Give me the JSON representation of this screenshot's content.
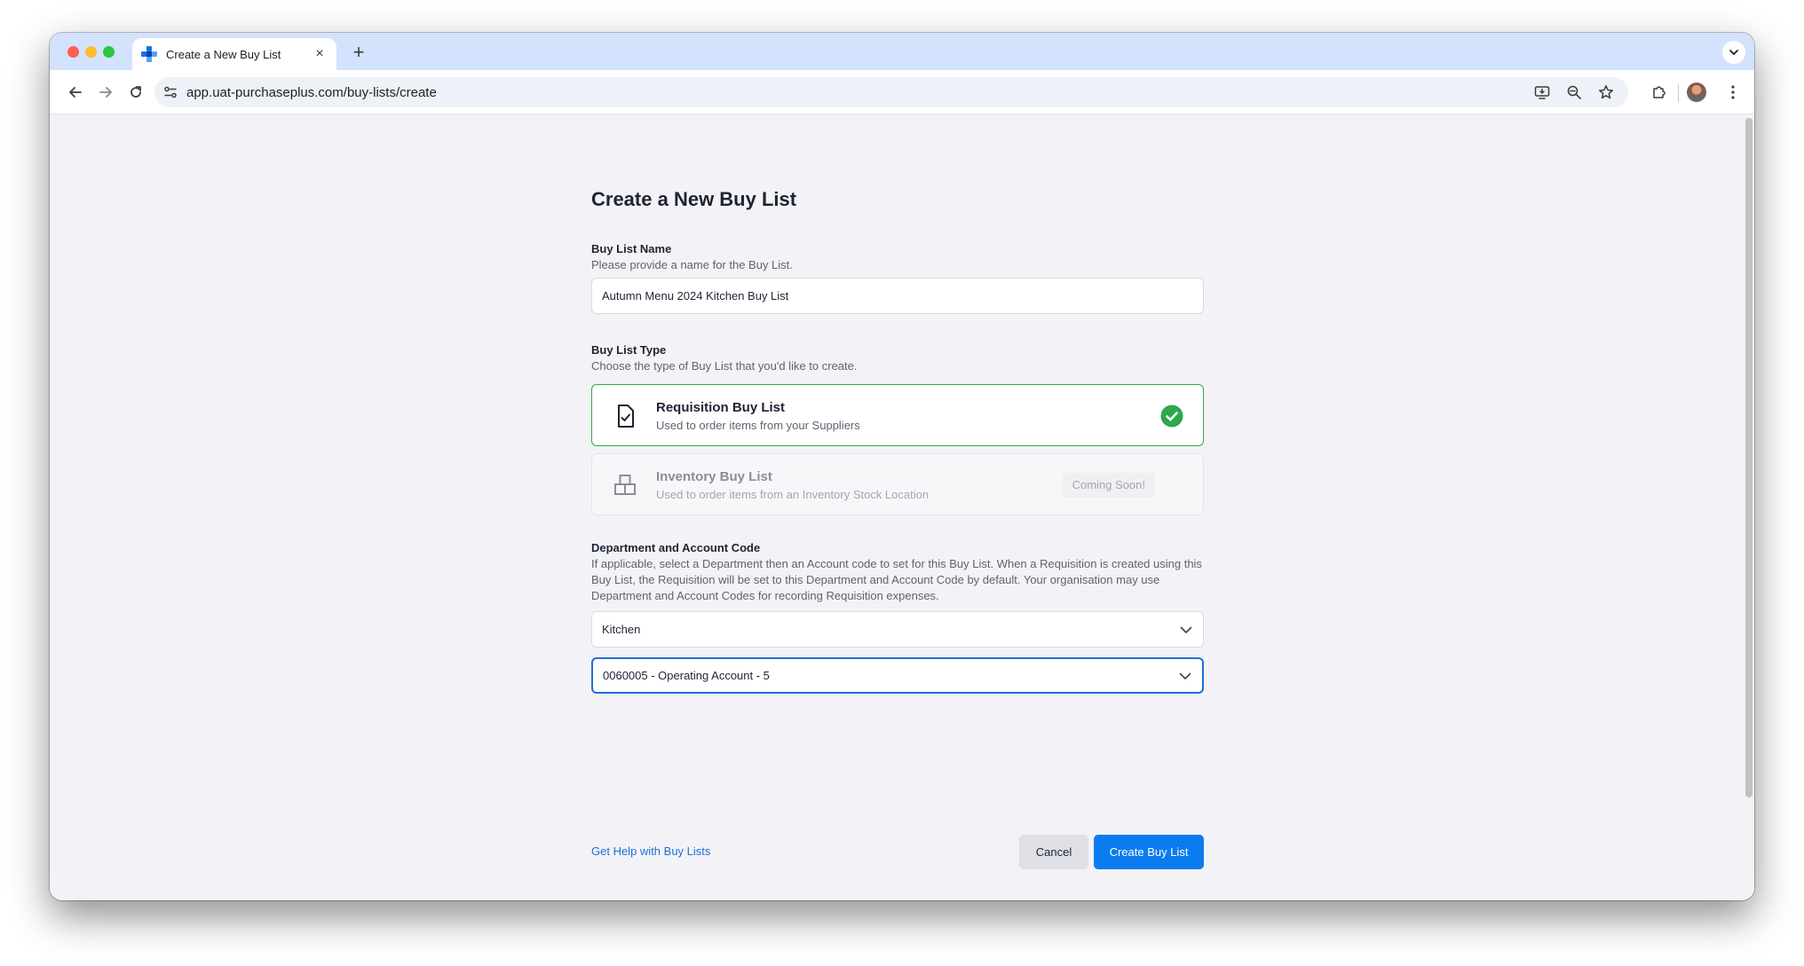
{
  "browser": {
    "tab_title": "Create a New Buy List",
    "new_tab_glyph": "+",
    "close_glyph": "×",
    "url": "app.uat-purchaseplus.com/buy-lists/create"
  },
  "page": {
    "title": "Create a New Buy List"
  },
  "buy_list_name": {
    "label": "Buy List Name",
    "help": "Please provide a name for the Buy List.",
    "value": "Autumn Menu 2024 Kitchen Buy List"
  },
  "buy_list_type": {
    "label": "Buy List Type",
    "help": "Choose the type of Buy List that you'd like to create.",
    "options": [
      {
        "title": "Requisition Buy List",
        "subtitle": "Used to order items from your Suppliers",
        "selected": true,
        "icon": "document-check-icon"
      },
      {
        "title": "Inventory Buy List",
        "subtitle": "Used to order items from an Inventory Stock Location",
        "badge": "Coming Soon!",
        "disabled": true,
        "icon": "boxes-icon"
      }
    ]
  },
  "department": {
    "label": "Department and Account Code",
    "help": "If applicable, select a Department then an Account code to set for this Buy List. When a Requisition is created using this Buy List, the Requisition will be set to this Department and Account Code by default. Your organisation may use Department and Account Codes for recording Requisition expenses.",
    "department_value": "Kitchen",
    "account_value": "0060005 - Operating Account - 5"
  },
  "footer": {
    "help_link": "Get Help with Buy Lists",
    "cancel_label": "Cancel",
    "create_label": "Create Buy List"
  },
  "colors": {
    "primary": "#0a7cef",
    "success": "#2ea84b",
    "focus": "#1f6fd6"
  }
}
